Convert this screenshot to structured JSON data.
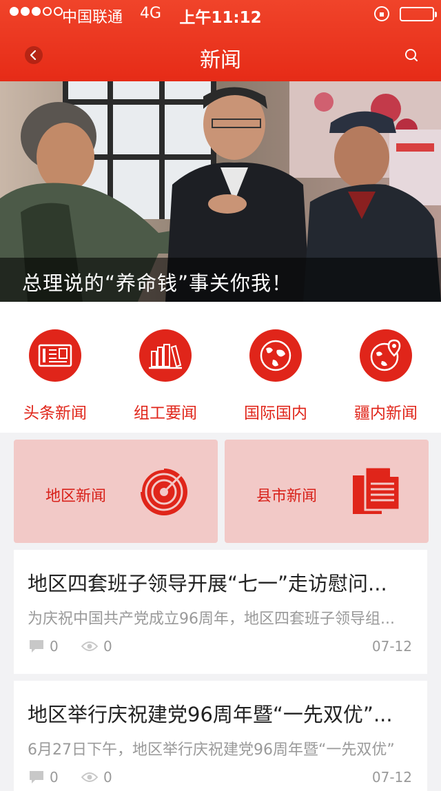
{
  "status_bar": {
    "carrier": "中国联通",
    "network": "4G",
    "time": "上午11:12"
  },
  "nav": {
    "title": "新闻",
    "back_icon": "chevron-left-icon",
    "search_icon": "search-icon"
  },
  "banner": {
    "caption": "总理说的“养命钱”事关你我！"
  },
  "categories": [
    {
      "label": "头条新闻",
      "icon": "newspaper-icon"
    },
    {
      "label": "组工要闻",
      "icon": "books-icon"
    },
    {
      "label": "国际国内",
      "icon": "globe-icon"
    },
    {
      "label": "疆内新闻",
      "icon": "map-pin-globe-icon"
    }
  ],
  "regions": [
    {
      "label": "地区新闻",
      "icon": "radar-icon"
    },
    {
      "label": "县市新闻",
      "icon": "documents-icon"
    }
  ],
  "news": [
    {
      "title": "地区四套班子领导开展“七一”走访慰问...",
      "summary": "为庆祝中国共产党成立96周年，地区四套班子领导组...",
      "comments": "0",
      "views": "0",
      "date": "07-12"
    },
    {
      "title": "地区举行庆祝建党96周年暨“一先双优”...",
      "summary": "6月27日下午，地区举行庆祝建党96周年暨“一先双优”",
      "comments": "0",
      "views": "0",
      "date": "07-12"
    }
  ],
  "colors": {
    "brand_red": "#e0251a",
    "card_pink": "#f2c9c7"
  }
}
